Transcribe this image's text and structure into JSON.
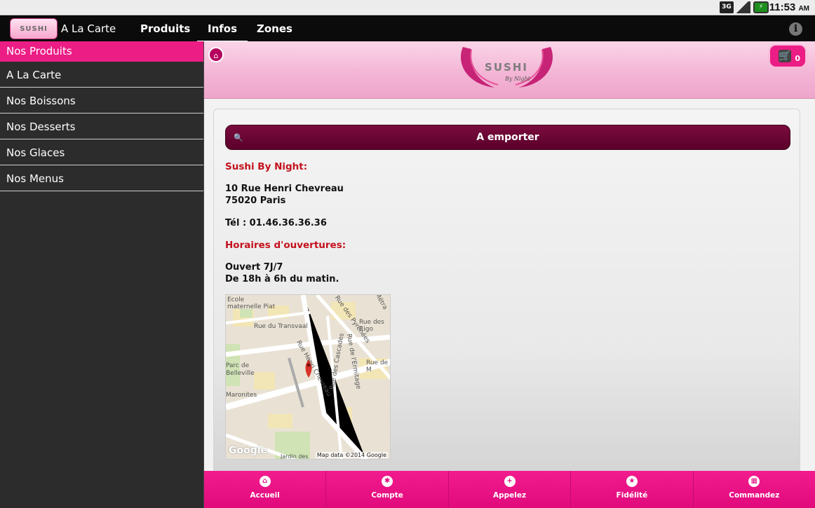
{
  "statusbar": {
    "network": "3G",
    "battery_icon": "battery-icon",
    "time": "11:53",
    "ampm": "AM"
  },
  "actionbar": {
    "logo_text": "SUSHI",
    "title": "A La Carte",
    "tabs": [
      {
        "label": "Produits",
        "active": false
      },
      {
        "label": "Infos",
        "active": true
      },
      {
        "label": "Zones",
        "active": false
      }
    ],
    "info_icon": "info-icon"
  },
  "sidebar": {
    "header": "Nos Produits",
    "items": [
      {
        "label": "A La Carte"
      },
      {
        "label": "Nos Boissons"
      },
      {
        "label": "Nos Desserts"
      },
      {
        "label": "Nos Glaces"
      },
      {
        "label": "Nos Menus"
      }
    ]
  },
  "header": {
    "home_icon": "home-icon",
    "brand_name": "SUSHI",
    "brand_tagline": "By Night",
    "cart_count": "0"
  },
  "mode_bar": {
    "label": "A emporter"
  },
  "info": {
    "shop_title": "Sushi By Night:",
    "address_line1": "10 Rue Henri Chevreau",
    "address_line2": "75020 Paris",
    "phone": "Tél : 01.46.36.36.36",
    "hours_title": "Horaires d'ouvertures:",
    "hours_line1": "Ouvert 7J/7",
    "hours_line2": "De 18h à 6h du matin."
  },
  "map": {
    "labels": {
      "ecole": "Ecole",
      "maternelle": "maternelle Piat",
      "transvaal": "Rue du Transvaal",
      "pyrenees": "Rue des Pyrénées",
      "rigo": "Rue des Rigo",
      "metra": "Métra",
      "cascades": "Rue des Cascades",
      "ermitage": "Rue de l'Ermitage",
      "henri": "Rue Henri Chevreau",
      "parc1": "Parc de",
      "parc2": "Belleville",
      "maronites": "Maronites",
      "ruedem": "Rue de M",
      "jardin": "Jardin des"
    },
    "google": "Google",
    "credit": "Map data ©2014 Google"
  },
  "bottom_nav": [
    {
      "label": "Accueil",
      "icon": "home-icon",
      "glyph": "⌂"
    },
    {
      "label": "Compte",
      "icon": "gear-icon",
      "glyph": "✱"
    },
    {
      "label": "Appelez",
      "icon": "plus-icon",
      "glyph": "+"
    },
    {
      "label": "Fidélité",
      "icon": "star-icon",
      "glyph": "★"
    },
    {
      "label": "Commandez",
      "icon": "grid-icon",
      "glyph": "▦"
    }
  ],
  "colors": {
    "accent": "#ec1d85",
    "dark_accent": "#5b002a",
    "red_text": "#c3121c"
  }
}
